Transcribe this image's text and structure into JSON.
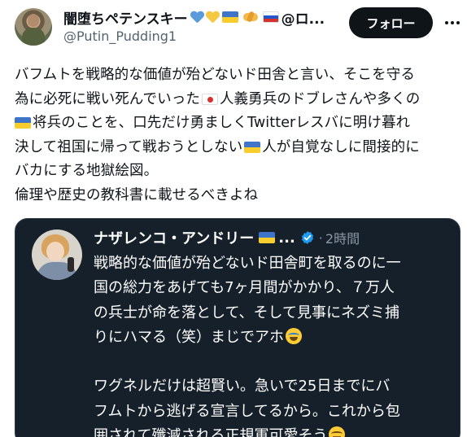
{
  "tweet": {
    "author": {
      "display_name": "闇堕ちペテンスキー",
      "name_suffix": "@ロ...",
      "handle": "@Putin_Pudding1",
      "name_emojis": [
        "blue-heart-icon",
        "yellow-heart-icon",
        "ukraine-flag-icon",
        "handshake-icon",
        "russia-flag-icon"
      ],
      "colors": {
        "blue_heart": "#5b9bd9",
        "yellow_heart": "#f5c842"
      }
    },
    "follow_label": "フォロー",
    "text_lines": [
      "バフムトを戦略的な価値が殆どないド田舎と言い、そこを守る",
      {
        "before": "為に必死に戦い死んでいった",
        "flag": "japan-flag-icon",
        "after": "人義勇兵のドブレさんや多くの"
      },
      {
        "before": "",
        "flag": "ukraine-flag-icon",
        "after": "将兵のことを、口先だけ勇ましくTwitterレスバに明け暮れ"
      },
      {
        "before": "決して祖国に帰って戦おうとしない",
        "flag": "ukraine-flag-icon",
        "after": "人が自覚なしに間接的に"
      },
      "バカにする地獄絵図。",
      "倫理や歴史の教科書に載せるべきよね"
    ]
  },
  "quoted_tweet": {
    "author_name": "ナザレンコ・アンドリー",
    "name_emoji": "ukraine-flag-icon",
    "ellipsis": "...",
    "separator": "·",
    "time": "2時間",
    "text_lines": [
      "戦略的な価値が殆どないド田舎町を取るのに一",
      "国の総力をあげても7ヶ月間がかかり、７万人",
      "の兵士が命を落として、そして見事にネズミ捕",
      "りにハマる（笑）まじでアホ",
      "",
      "ワグネルだけは超賢い。急いで25日までにバ",
      "フムトから逃げる宣言してるから。これから包",
      "囲されて殲滅される正規軍可愛そう"
    ],
    "line_emojis": {
      "3": "laughing-crying-face-icon",
      "7": "smiling-tear-face-icon"
    },
    "colors": {
      "background": "#15202b",
      "verified": "#1d9bf0"
    }
  }
}
